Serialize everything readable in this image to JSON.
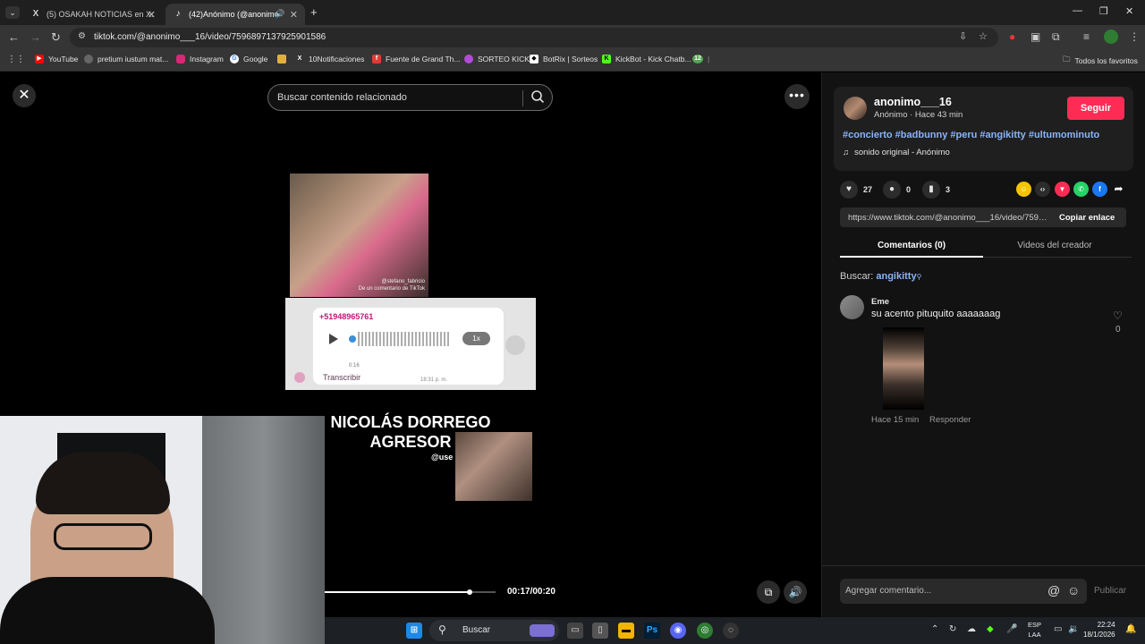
{
  "browser": {
    "tabs": [
      {
        "title": "(5) OSAKAH NOTICIAS en X: \"@",
        "icon": "x-icon"
      },
      {
        "title": "(42)Anónimo (@anonimo_",
        "icon": "tiktok-icon"
      }
    ],
    "url": "tiktok.com/@anonimo___16/video/7596897137925901586",
    "bookmarks": [
      {
        "label": "YouTube",
        "icon": "youtube-icon",
        "color": "#ff0000"
      },
      {
        "label": "pretium iustum mat...",
        "icon": "globe-icon",
        "color": "#bbbbbb"
      },
      {
        "label": "Instagram",
        "icon": "instagram-icon",
        "color": "#d62976"
      },
      {
        "label": "Google",
        "icon": "google-icon",
        "color": "#ffffff"
      },
      {
        "label": "",
        "icon": "puzzle-icon",
        "color": "#e2b13c"
      },
      {
        "label": "10Notificaciones",
        "icon": "x-icon",
        "color": "#ffffff"
      },
      {
        "label": "Fuente de Grand Th...",
        "icon": "f-icon",
        "color": "#e53935"
      },
      {
        "label": "SORTEO KICK",
        "icon": "kick-icon",
        "color": "#b44bd6"
      },
      {
        "label": "BotRix | Sorteos",
        "icon": "diamond-icon",
        "color": "#ffffff"
      },
      {
        "label": "KickBot - Kick Chatb...",
        "icon": "kickbot-icon",
        "color": "#53fc18"
      },
      {
        "label": "12",
        "icon": "badge-icon",
        "color": "#53a653"
      }
    ],
    "all_bookmarks_label": "Todos los favoritos"
  },
  "video": {
    "search_placeholder": "Buscar contenido relacionado",
    "clip_caption_user": "@stefano_fabricio",
    "clip_caption_text": "De un comentario de TikTok",
    "chat_phone": "+51948965761",
    "chat_speed": "1x",
    "chat_duration": "0:16",
    "chat_transcribe": "Transcribir",
    "chat_time": "18:31 p. m.",
    "headline_line1": "NICOLÁS DORREGO",
    "headline_line2": "AGRESOR",
    "user_tag": "@use",
    "time": "00:17/00:20",
    "progress": 0.85
  },
  "panel": {
    "author": "anonimo___16",
    "author_sub": "Anónimo · Hace 43 min",
    "follow": "Seguir",
    "hashtags": "#concierto #badbunny #peru #angikitty #ultumominuto",
    "sound": "sonido original - Anónimo",
    "likes": "27",
    "comments": "0",
    "saves": "3",
    "link": "https://www.tiktok.com/@anonimo___16/video/7596897137925901586",
    "copy": "Copiar enlace",
    "tab_comments": "Comentarios (0)",
    "tab_videos": "Videos del creador",
    "search_prefix": "Buscar:",
    "search_term": "angikitty",
    "comment": {
      "name": "Eme",
      "text": "su acento pituquito aaaaaaag",
      "time": "Hace 15 min",
      "reply": "Responder",
      "likes": "0"
    },
    "add_comment": "Agregar comentario...",
    "publish": "Publicar"
  },
  "taskbar": {
    "search": "Buscar",
    "lang_line1": "ESP",
    "lang_line2": "LAA",
    "time": "22:24",
    "date": "18/1/2026"
  },
  "colors": {
    "follow": "#fe2c55",
    "hashtag": "#8ab4f8"
  }
}
